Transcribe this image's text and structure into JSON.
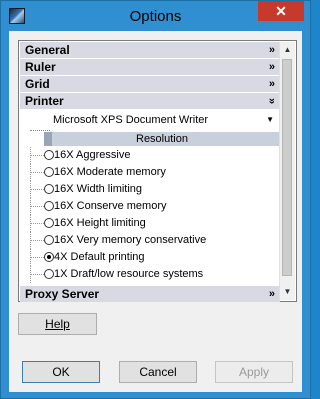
{
  "window": {
    "title": "Options",
    "close_glyph": "✕"
  },
  "sections": {
    "general": {
      "label": "General",
      "chevron": "»"
    },
    "ruler": {
      "label": "Ruler",
      "chevron": "»"
    },
    "grid": {
      "label": "Grid",
      "chevron": "»"
    },
    "printer": {
      "label": "Printer",
      "chevron": "«"
    },
    "proxy": {
      "label": "Proxy Server",
      "chevron": "»"
    }
  },
  "printer": {
    "selected_printer": "Microsoft XPS Document Writer",
    "resolution_header": "Resolution",
    "options": [
      {
        "label": "16X Aggressive",
        "selected": false
      },
      {
        "label": "16X Moderate memory",
        "selected": false
      },
      {
        "label": "16X Width limiting",
        "selected": false
      },
      {
        "label": "16X Conserve memory",
        "selected": false
      },
      {
        "label": "16X Height limiting",
        "selected": false
      },
      {
        "label": "16X Very memory conservative",
        "selected": false
      },
      {
        "label": "4X Default printing",
        "selected": true
      },
      {
        "label": "1X Draft/low resource systems",
        "selected": false
      }
    ]
  },
  "buttons": {
    "help": "Help",
    "ok": "OK",
    "cancel": "Cancel",
    "apply": "Apply"
  },
  "colors": {
    "titlebar": "#2f8fd0",
    "close": "#c7392b",
    "section_bg": "#d9d9e3"
  }
}
